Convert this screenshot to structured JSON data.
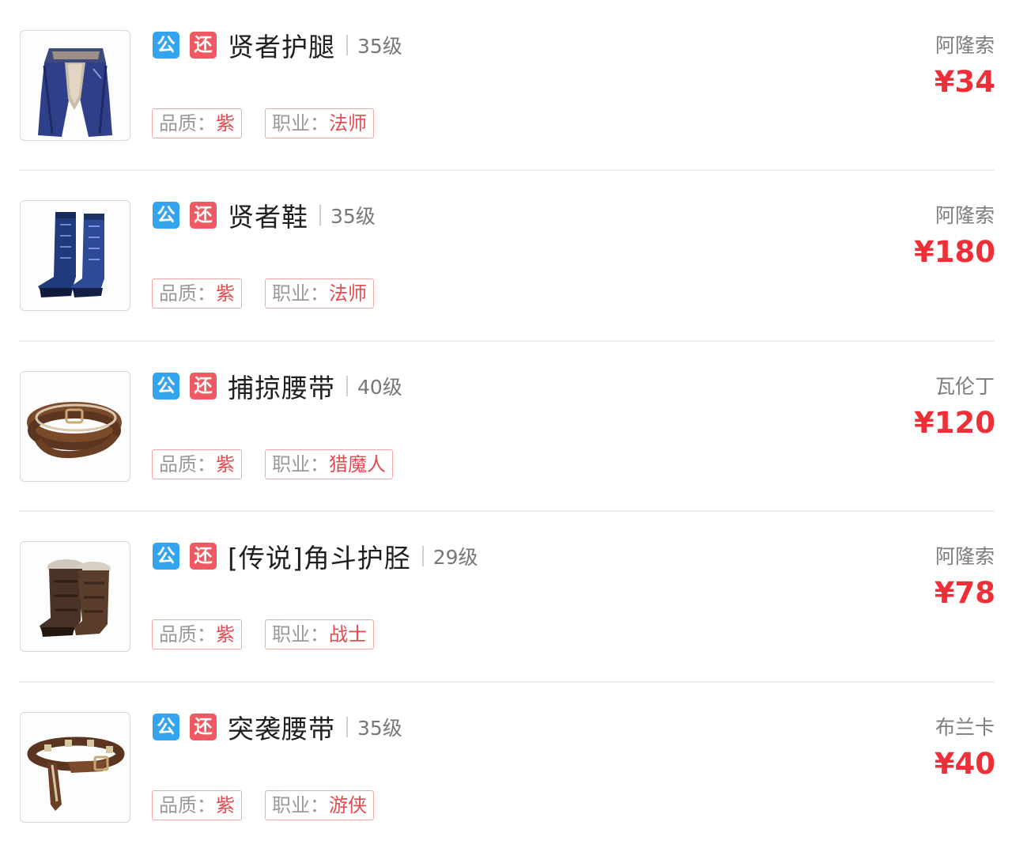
{
  "listings": [
    {
      "badge_public": "公",
      "badge_return": "还",
      "name": "贤者护腿",
      "level": "35级",
      "quality_key": "品质：",
      "quality_value": "紫",
      "job_key": "职业：",
      "job_value": "法师",
      "seller": "阿隆索",
      "price": "¥34",
      "thumbnail_icon": "mage-leggings-icon"
    },
    {
      "badge_public": "公",
      "badge_return": "还",
      "name": "贤者鞋",
      "level": "35级",
      "quality_key": "品质：",
      "quality_value": "紫",
      "job_key": "职业：",
      "job_value": "法师",
      "seller": "阿隆索",
      "price": "¥180",
      "thumbnail_icon": "mage-boots-icon"
    },
    {
      "badge_public": "公",
      "badge_return": "还",
      "name": "捕掠腰带",
      "level": "40级",
      "quality_key": "品质：",
      "quality_value": "紫",
      "job_key": "职业：",
      "job_value": "猎魔人",
      "seller": "瓦伦丁",
      "price": "¥120",
      "thumbnail_icon": "leather-belt-icon"
    },
    {
      "badge_public": "公",
      "badge_return": "还",
      "name": "[传说]角斗护胫",
      "level": "29级",
      "quality_key": "品质：",
      "quality_value": "紫",
      "job_key": "职业：",
      "job_value": "战士",
      "seller": "阿隆索",
      "price": "¥78",
      "thumbnail_icon": "fur-boots-icon"
    },
    {
      "badge_public": "公",
      "badge_return": "还",
      "name": "突袭腰带",
      "level": "35级",
      "quality_key": "品质：",
      "quality_value": "紫",
      "job_key": "职业：",
      "job_value": "游侠",
      "seller": "布兰卡",
      "price": "¥40",
      "thumbnail_icon": "studded-belt-icon"
    }
  ],
  "colors": {
    "badge_public": "#35a4ef",
    "badge_return": "#ef5a62",
    "price": "#ee2f38",
    "tag_border": "#f1a6a9",
    "tag_value": "#e24b52"
  }
}
